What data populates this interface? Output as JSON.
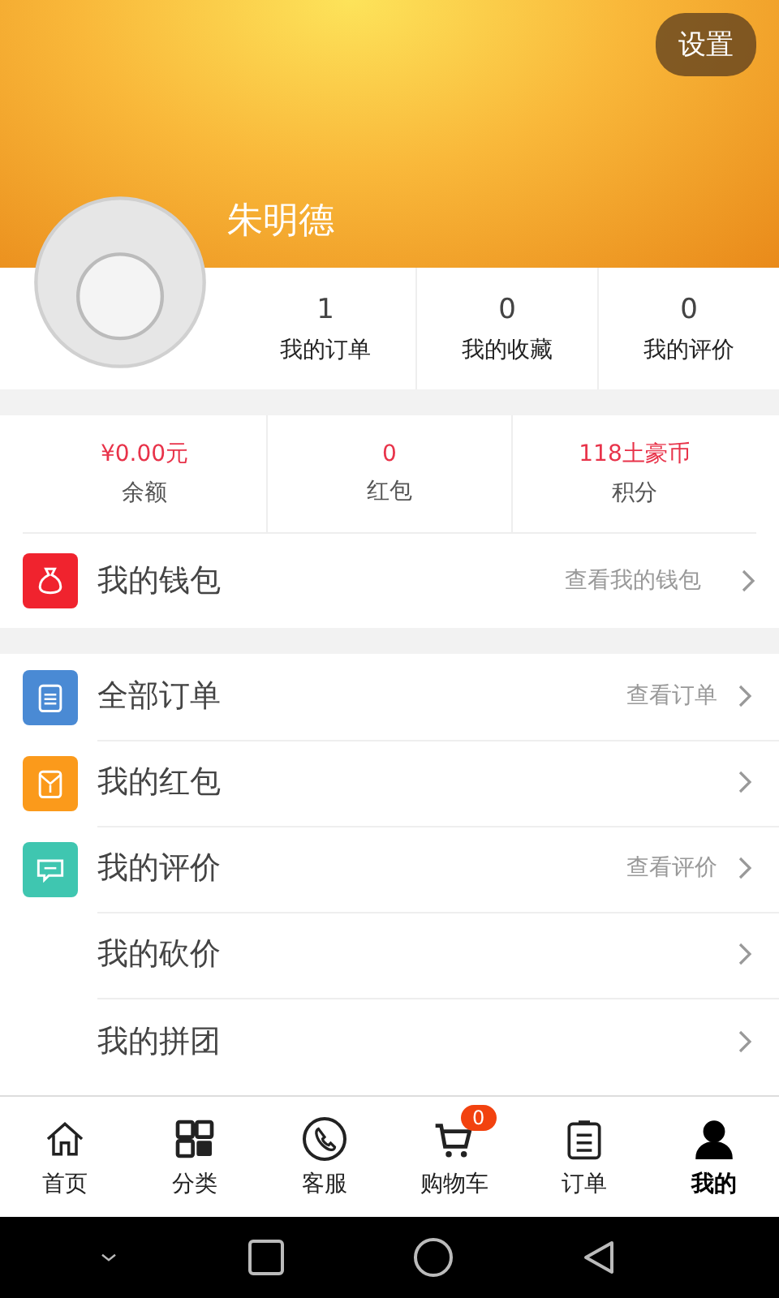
{
  "header": {
    "settings_button": "设置",
    "username": "朱明德"
  },
  "stats": [
    {
      "value": "1",
      "label": "我的订单"
    },
    {
      "value": "0",
      "label": "我的收藏"
    },
    {
      "value": "0",
      "label": "我的评价"
    }
  ],
  "assets": [
    {
      "value": "¥0.00元",
      "label": "余额"
    },
    {
      "value": "0",
      "label": "红包"
    },
    {
      "value": "118土豪币",
      "label": "积分"
    }
  ],
  "wallet": {
    "kind": "wallet",
    "color": "#f0232e",
    "label": "我的钱包",
    "hint": "查看我的钱包"
  },
  "menu": [
    {
      "kind": "orders",
      "color": "#4a8ad4",
      "label": "全部订单",
      "hint": "查看订单"
    },
    {
      "kind": "redpacket",
      "color": "#fb9a1b",
      "label": "我的红包"
    },
    {
      "kind": "review",
      "color": "#3fc6b0",
      "label": "我的评价",
      "hint": "查看评价"
    },
    {
      "kind": "plain",
      "label": "我的砍价"
    },
    {
      "kind": "plain",
      "label": "我的拼团"
    }
  ],
  "tabbar": [
    {
      "kind": "home",
      "label": "首页",
      "selected": false
    },
    {
      "kind": "grid",
      "label": "分类",
      "selected": false
    },
    {
      "kind": "phone",
      "label": "客服",
      "selected": false
    },
    {
      "kind": "cart",
      "label": "购物车",
      "badge": "0",
      "selected": false
    },
    {
      "kind": "list",
      "label": "订单",
      "selected": false
    },
    {
      "kind": "person",
      "label": "我的",
      "selected": true
    }
  ]
}
